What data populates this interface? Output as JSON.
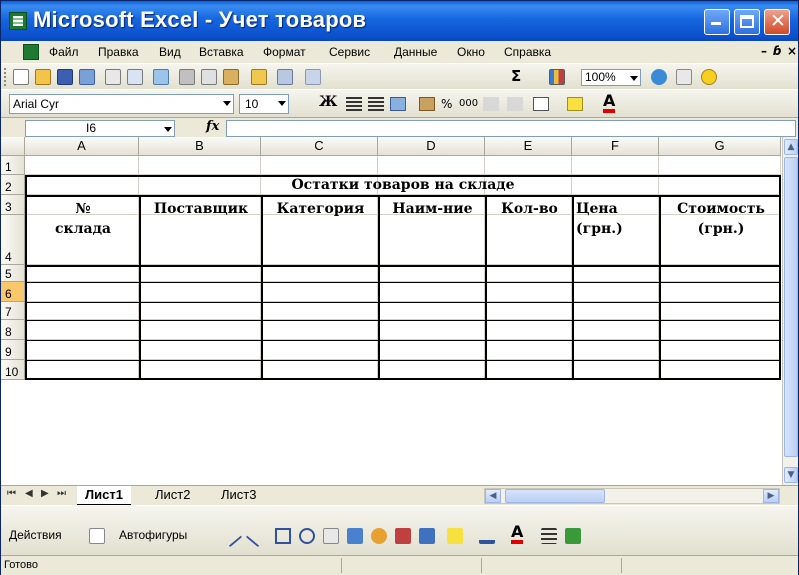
{
  "window": {
    "title": "Microsoft Excel - Учет товаров"
  },
  "menu": [
    "Файл",
    "Правка",
    "Вид",
    "Вставка",
    "Формат",
    "Сервис",
    "Данные",
    "Окно",
    "Справка"
  ],
  "standard_toolbar": {
    "zoom": "100%",
    "autosum": "Σ"
  },
  "formatting_toolbar": {
    "font_name": "Arial Cyr",
    "font_size": "10",
    "bold_label": "Ж",
    "percent": "%",
    "thousands": "000"
  },
  "formula_bar": {
    "name_box": "I6",
    "fx_label": "fx",
    "value": ""
  },
  "columns": [
    "A",
    "B",
    "C",
    "D",
    "E",
    "F",
    "G"
  ],
  "rows": [
    "1",
    "2",
    "3",
    "4",
    "5",
    "6",
    "7",
    "8",
    "9",
    "10"
  ],
  "active_row": "6",
  "table": {
    "title": "Остатки товаров на складе",
    "headers": [
      {
        "line1": "№",
        "line2": "склада"
      },
      {
        "line1": "Поставщик",
        "line2": ""
      },
      {
        "line1": "Категория",
        "line2": ""
      },
      {
        "line1": "Наим-ние",
        "line2": ""
      },
      {
        "line1": "Кол-во",
        "line2": ""
      },
      {
        "line1": "Цена",
        "line2": "(грн.)"
      },
      {
        "line1": "Стоимость",
        "line2": "(грн.)"
      }
    ]
  },
  "sheets": [
    "Лист1",
    "Лист2",
    "Лист3"
  ],
  "active_sheet": "Лист1",
  "drawing_toolbar": {
    "actions": "Действия",
    "autoshapes": "Автофигуры"
  },
  "status": "Готово",
  "colors": {
    "title_bar": "#0a5fd8",
    "excel_green": "#1e7a30",
    "active_row_header": "#f9c86b"
  }
}
